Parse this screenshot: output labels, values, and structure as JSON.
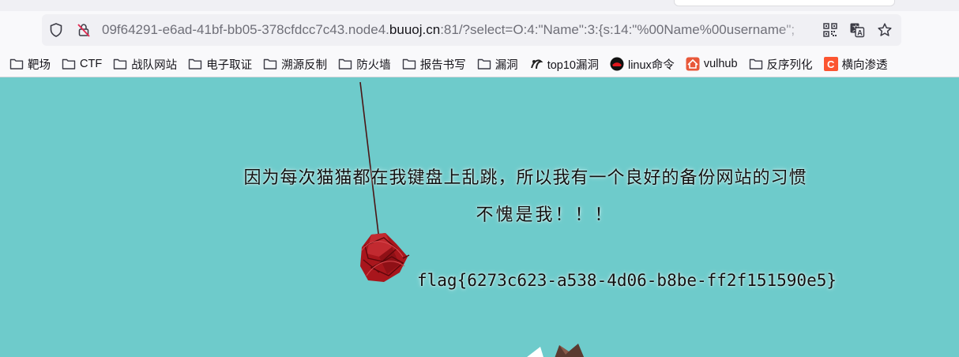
{
  "browser": {
    "url_prefix": "09f64291-e6ad-41bf-bb05-378cfdcc7c43.node4.",
    "url_domain": "buuoj.cn",
    "url_suffix": ":81/?select=O:4:\"Name\":3:{s:14:\"%00Name%00username\";",
    "icons": [
      "shield-icon",
      "insecure-lock-icon",
      "qr-code-icon",
      "translate-icon",
      "bookmark-star-icon"
    ]
  },
  "bookmarks": [
    {
      "label": "靶场",
      "icon": "folder-icon"
    },
    {
      "label": "CTF",
      "icon": "folder-icon"
    },
    {
      "label": "战队网站",
      "icon": "folder-icon"
    },
    {
      "label": "电子取证",
      "icon": "folder-icon"
    },
    {
      "label": "溯源反制",
      "icon": "folder-icon"
    },
    {
      "label": "防火墙",
      "icon": "folder-icon"
    },
    {
      "label": "报告书写",
      "icon": "folder-icon"
    },
    {
      "label": "漏洞",
      "icon": "folder-icon"
    },
    {
      "label": "top10漏洞",
      "icon": "site-favicon"
    },
    {
      "label": "linux命令",
      "icon": "redhat-favicon"
    },
    {
      "label": "vulhub",
      "icon": "home-favicon"
    },
    {
      "label": "反序列化",
      "icon": "folder-icon"
    },
    {
      "label": "横向渗透",
      "icon": "c-favicon"
    }
  ],
  "page": {
    "line1": "因为每次猫猫都在我键盘上乱跳，所以我有一个良好的备份网站的习惯",
    "line2": "不愧是我！！！",
    "flag": "flag{6273c623-a538-4d06-b8be-ff2f151590e5}",
    "background_color": "#6ecbcb",
    "decor": [
      "yarn-ball-image",
      "cat-image"
    ]
  }
}
